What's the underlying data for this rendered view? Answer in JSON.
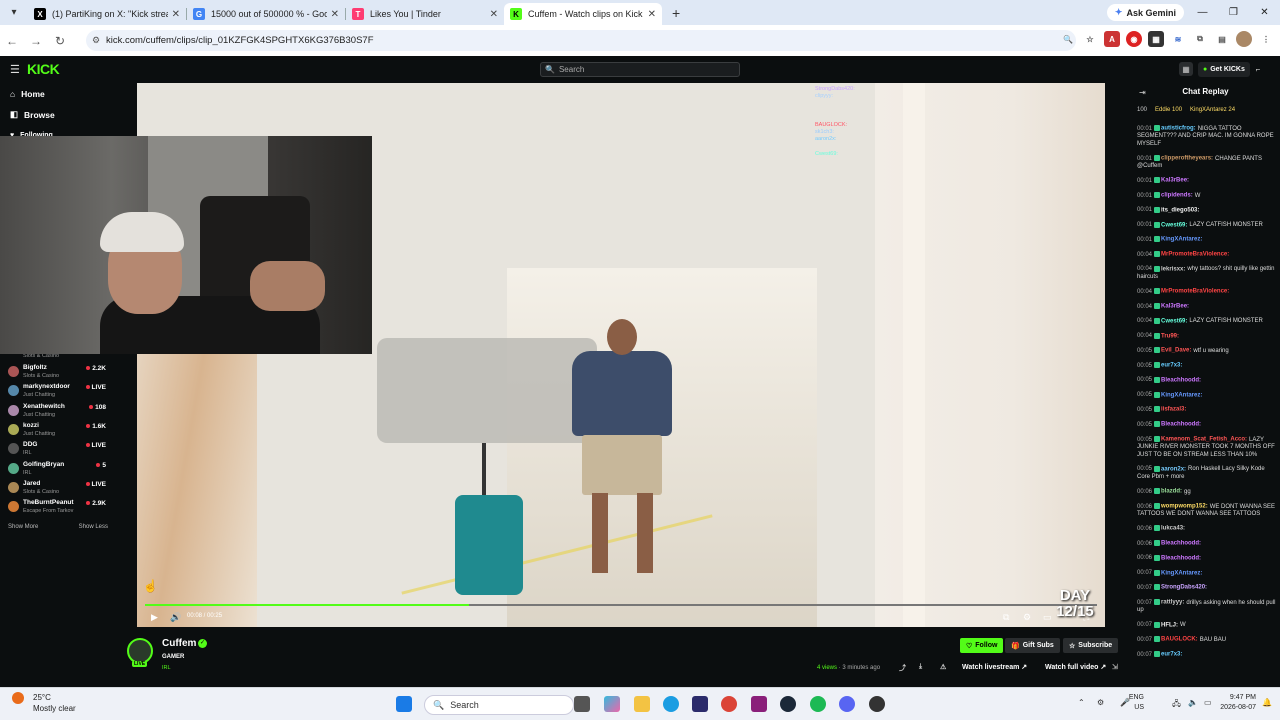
{
  "browser": {
    "tabs": [
      {
        "label": "(1) PartiKing on X: \"Kick stream",
        "favicon": "X",
        "color": "#000000",
        "active": false
      },
      {
        "label": "15000 out of 500000 % - Goog",
        "favicon": "G",
        "color": "#4285f4",
        "active": false
      },
      {
        "label": "Likes You | Tinder",
        "favicon": "T",
        "color": "#fe3c72",
        "active": false
      },
      {
        "label": "Cuffem - Watch clips on Kick",
        "favicon": "K",
        "color": "#53fc18",
        "active": true
      }
    ],
    "gemini_label": "Ask Gemini",
    "url": "kick.com/cuffem/clips/clip_01KZFGK4SPGHTX6KG376B30S7F"
  },
  "kick": {
    "logo": "KICK",
    "search_placeholder": "Search",
    "get_kicks": "Get KICKs",
    "nav": [
      "Home",
      "Browse",
      "Following"
    ],
    "channels": [
      {
        "name": "",
        "category": "Slots & Casino",
        "viewers": "",
        "color": "#8a5"
      },
      {
        "name": "Bigfoltz",
        "category": "Slots & Casino",
        "viewers": "2.2K",
        "color": "#a55"
      },
      {
        "name": "markynextdoor",
        "category": "Just Chatting",
        "viewers": "LIVE",
        "color": "#58a"
      },
      {
        "name": "Xenathewitch",
        "category": "Just Chatting",
        "viewers": "108",
        "color": "#a8a"
      },
      {
        "name": "kozzi",
        "category": "Just Chatting",
        "viewers": "1.6K",
        "color": "#aa5"
      },
      {
        "name": "DDG",
        "category": "IRL",
        "viewers": "LIVE",
        "color": "#555"
      },
      {
        "name": "GolfingBryan",
        "category": "IRL",
        "viewers": "5",
        "color": "#5a8"
      },
      {
        "name": "Jared",
        "category": "Slots & Casino",
        "viewers": "LIVE",
        "color": "#a85"
      },
      {
        "name": "TheBurntPeanut",
        "category": "Escape From Tarkov",
        "viewers": "2.9K",
        "color": "#c73"
      }
    ],
    "show_more": "Show More",
    "show_less": "Show Less",
    "overlay_chat": [
      {
        "user": "StrongDabs420:",
        "color": "#c9a4ff"
      },
      {
        "user": "clipyyy:",
        "color": "#a8d0ff"
      },
      {
        "user": "BAUGLOCK:",
        "color": "#ff5566"
      },
      {
        "user": "sk1ch3:",
        "color": "#9cf"
      },
      {
        "user": "aaron2x:",
        "color": "#7cf"
      },
      {
        "user": "Cwest69:",
        "color": "#6fd"
      }
    ],
    "player": {
      "time": "00:08 / 00:25",
      "progress": 0.34,
      "day_badge_line1": "DAY",
      "day_badge_line2": "12/15"
    },
    "channel": {
      "name": "Cuffem",
      "live": "LIVE",
      "title": "GAMER",
      "category": "IRL",
      "follow": "Follow",
      "gift": "Gift Subs",
      "subscribe": "Subscribe",
      "views": "4 views",
      "ago": "3 minutes ago",
      "watch_live": "Watch livestream",
      "watch_full": "Watch full video"
    },
    "chat": {
      "title": "Chat Replay",
      "leaderboard": [
        "100",
        "Eddie 100",
        "KingXAntarez 24"
      ],
      "messages": [
        {
          "time": "00:01",
          "user": "autisticfrog:",
          "color": "#6cf",
          "text": "NIGGA TATTOO SEGMENT??? AND CRIP MAC. IM GONNA ROPE MYSELF"
        },
        {
          "time": "00:01",
          "user": "clipperoftheyears:",
          "color": "#c96",
          "text": "CHANGE PANTS @Cuffem"
        },
        {
          "time": "00:01",
          "user": "Kal3rBee:",
          "color": "#c7f",
          "text": ""
        },
        {
          "time": "00:01",
          "user": "clipidends:",
          "color": "#c7f",
          "text": "W"
        },
        {
          "time": "00:01",
          "user": "its_diego503:",
          "color": "#eee",
          "text": ""
        },
        {
          "time": "00:01",
          "user": "Cwest69:",
          "color": "#6fd",
          "text": "LAZY CATFISH MONSTER"
        },
        {
          "time": "00:01",
          "user": "KingXAntarez:",
          "color": "#69f",
          "text": ""
        },
        {
          "time": "00:04",
          "user": "MrPromoteBraViolence:",
          "color": "#f44",
          "text": ""
        },
        {
          "time": "00:04",
          "user": "lekrisxx:",
          "color": "#ccc",
          "text": "why tattoos? shit quilly like gettin haircuts"
        },
        {
          "time": "00:04",
          "user": "MrPromoteBraViolence:",
          "color": "#f44",
          "text": ""
        },
        {
          "time": "00:04",
          "user": "Kal3rBee:",
          "color": "#c7f",
          "text": ""
        },
        {
          "time": "00:04",
          "user": "Cwest69:",
          "color": "#6fd",
          "text": "LAZY CATFISH MONSTER"
        },
        {
          "time": "00:04",
          "user": "Tru99:",
          "color": "#f55",
          "text": ""
        },
        {
          "time": "00:05",
          "user": "Evil_Dave:",
          "color": "#f55",
          "text": "wtf u wearing"
        },
        {
          "time": "00:05",
          "user": "eur7x3:",
          "color": "#6cf",
          "text": ""
        },
        {
          "time": "00:05",
          "user": "Bleachhoodd:",
          "color": "#c7f",
          "text": ""
        },
        {
          "time": "00:05",
          "user": "KingXAntarez:",
          "color": "#69f",
          "text": ""
        },
        {
          "time": "00:05",
          "user": "iisfazal3:",
          "color": "#f55",
          "text": ""
        },
        {
          "time": "00:05",
          "user": "Bleachhoodd:",
          "color": "#c7f",
          "text": ""
        },
        {
          "time": "00:05",
          "user": "Kamenom_Scat_Fetish_Acco:",
          "color": "#f55",
          "text": "LAZY JUNKIE RIVER MONSTER TOOK 7 MONTHS OFF JUST TO BE ON STREAM LESS THAN 10%"
        },
        {
          "time": "00:05",
          "user": "aaron2x:",
          "color": "#7cf",
          "text": "Ron Haskell Lacy Silky Kode Core Pbm + more"
        },
        {
          "time": "00:06",
          "user": "blazdd:",
          "color": "#9d9",
          "text": "gg"
        },
        {
          "time": "00:06",
          "user": "wompwomp152:",
          "color": "#fd6",
          "text": "WE DONT WANNA SEE TATTOOS  WE DONT WANNA SEE TATTOOS"
        },
        {
          "time": "00:06",
          "user": "lukca43:",
          "color": "#ccc",
          "text": ""
        },
        {
          "time": "00:06",
          "user": "Bleachhoodd:",
          "color": "#c7f",
          "text": ""
        },
        {
          "time": "00:06",
          "user": "Bleachhoodd:",
          "color": "#c7f",
          "text": ""
        },
        {
          "time": "00:07",
          "user": "KingXAntarez:",
          "color": "#69f",
          "text": ""
        },
        {
          "time": "00:07",
          "user": "StrongDabs420:",
          "color": "#c9a4ff",
          "text": ""
        },
        {
          "time": "00:07",
          "user": "rattlyyy:",
          "color": "#ccc",
          "text": "drillys asking when he should pull up"
        },
        {
          "time": "00:07",
          "user": "HFLJ:",
          "color": "#eee",
          "text": "W"
        },
        {
          "time": "00:07",
          "user": "BAUGLOCK:",
          "color": "#f44",
          "text": "BAU BAU"
        },
        {
          "time": "00:07",
          "user": "eur7x3:",
          "color": "#6cf",
          "text": ""
        }
      ]
    }
  },
  "taskbar": {
    "temp": "25°C",
    "weather": "Mostly clear",
    "search": "Search",
    "lang1": "ENG",
    "lang2": "US",
    "time": "9:47 PM",
    "date": "2026-08-07"
  }
}
